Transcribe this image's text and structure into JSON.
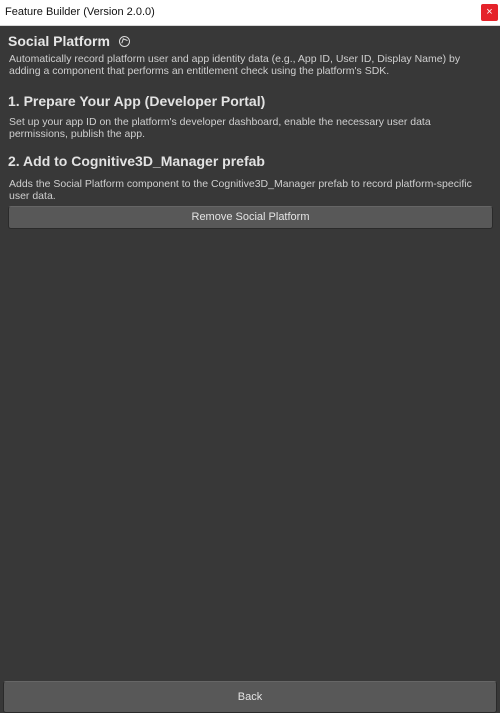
{
  "window": {
    "title": "Feature Builder (Version 2.0.0)",
    "close_symbol": "×"
  },
  "main": {
    "heading": "Social Platform",
    "heading_icon": "help-circle-icon",
    "description": "Automatically record platform user and app identity data (e.g., App ID, User ID, Display Name) by adding a component that performs an entitlement check using the platform's SDK.",
    "sections": [
      {
        "heading": "1. Prepare Your App (Developer Portal)",
        "text": "Set up your app ID on the platform's developer dashboard, enable the necessary user data permissions, publish the app."
      },
      {
        "heading": "2. Add to Cognitive3D_Manager prefab",
        "text": "Adds the Social Platform component to the Cognitive3D_Manager prefab to record platform-specific user data."
      }
    ],
    "action_button": "Remove Social Platform"
  },
  "footer": {
    "back_label": "Back"
  },
  "colors": {
    "background": "#383838",
    "button": "#585858",
    "close": "#e5232a"
  }
}
